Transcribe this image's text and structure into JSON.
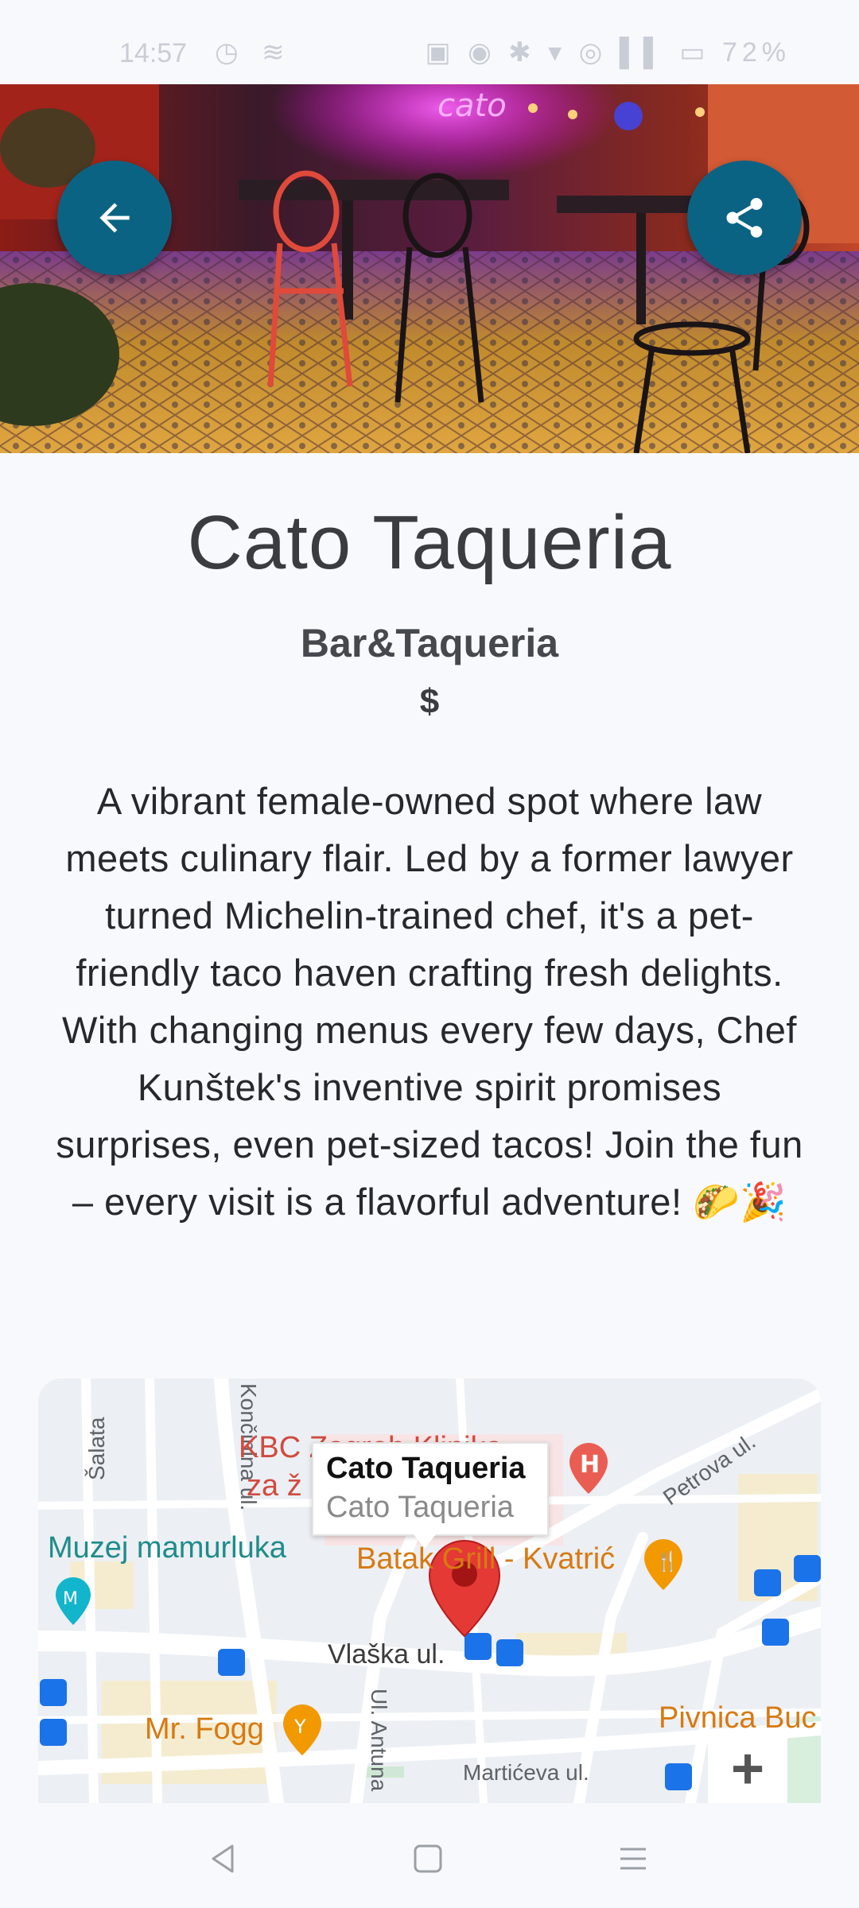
{
  "status_bar": {
    "time": "14:57",
    "left_icons": "◷ ≋",
    "right_icons": "▣ ◉ ✱ ▾ ◎ ▌▌ ▭ 72%",
    "battery": "72%"
  },
  "hero": {
    "image": "restaurant-interior-photo",
    "back_icon": "arrow-left-icon",
    "share_icon": "share-icon"
  },
  "place": {
    "name": "Cato Taqueria",
    "category": "Bar&Taqueria",
    "price": "$",
    "description": "A vibrant female-owned spot where law meets culinary flair. Led by a former lawyer turned Michelin-trained chef, it's a pet-friendly taco haven crafting fresh delights. With changing menus every few days, Chef Kunštek's inventive spirit promises surprises, even pet-sized tacos! Join the fun – every visit is a flavorful adventure! 🌮🎉"
  },
  "map": {
    "info_title": "Cato Taqueria",
    "info_subtitle": "Cato Taqueria",
    "zoom_in": "+",
    "labels": {
      "salata": "Šalata",
      "oncinina": "Končinina ul.",
      "kbc": "KBC Zagreb Klinika",
      "kbc_line2": "za ž",
      "muzej": "Muzej mamurluka",
      "batak": "Batak Grill - Kvatrić",
      "petrova": "Petrova ul.",
      "vlaska": "Vlaška ul.",
      "mr_fogg": "Mr. Fogg",
      "antuna": "Ul. Antuna",
      "marticeva": "Martićeva ul.",
      "pivnica": "Pivnica Buc"
    },
    "colors": {
      "pin": "#e53935",
      "poi_orange": "#f29900",
      "poi_teal": "#12b5cb",
      "poi_red": "#ea4335",
      "transit": "#1a73e8"
    }
  },
  "nav": {
    "back_icon": "nav-back-icon",
    "home_icon": "nav-home-icon",
    "recent_icon": "nav-recent-icon"
  }
}
